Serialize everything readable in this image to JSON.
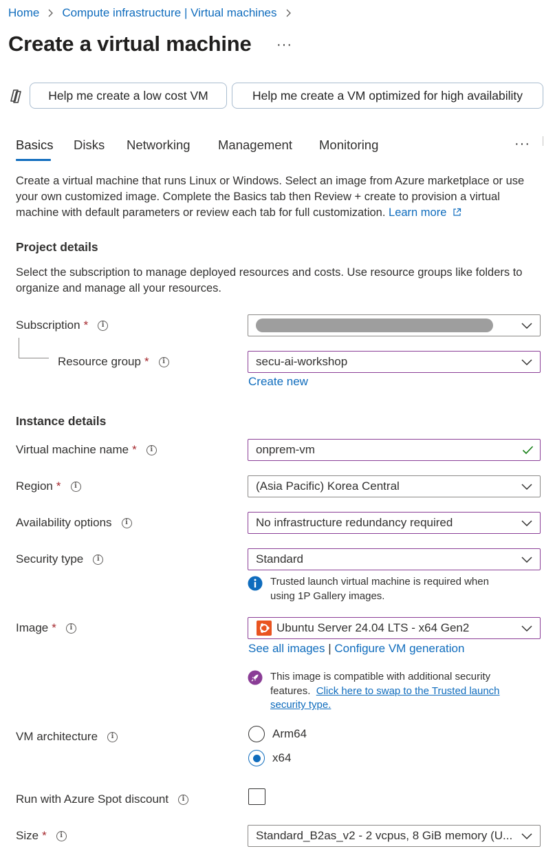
{
  "breadcrumb": {
    "items": [
      "Home",
      "Compute infrastructure | Virtual machines"
    ]
  },
  "page": {
    "title": "Create a virtual machine",
    "more": "···"
  },
  "copilot": {
    "btn_low_cost": "Help me create a low cost VM",
    "btn_high_avail": "Help me create a VM optimized for high availability"
  },
  "tabs": {
    "items": [
      "Basics",
      "Disks",
      "Networking",
      "Management",
      "Monitoring"
    ],
    "active": "Basics",
    "more": "···"
  },
  "intro": {
    "text": "Create a virtual machine that runs Linux or Windows. Select an image from Azure marketplace or use your own customized image. Complete the Basics tab then Review + create to provision a virtual machine with default parameters or review each tab for full customization.",
    "learn_more": "Learn more"
  },
  "project": {
    "heading": "Project details",
    "description": "Select the subscription to manage deployed resources and costs. Use resource groups like folders to organize and manage all your resources.",
    "subscription_label": "Subscription",
    "resource_group_label": "Resource group",
    "resource_group_value": "secu-ai-workshop",
    "create_new": "Create new"
  },
  "instance": {
    "heading": "Instance details",
    "vm_name_label": "Virtual machine name",
    "vm_name_value": "onprem-vm",
    "region_label": "Region",
    "region_value": "(Asia Pacific) Korea Central",
    "availability_label": "Availability options",
    "availability_value": "No infrastructure redundancy required",
    "security_label": "Security type",
    "security_value": "Standard",
    "security_note_line1": "Trusted launch virtual machine is required when",
    "security_note_line2": "using 1P Gallery images.",
    "image_label": "Image",
    "image_value": "Ubuntu Server 24.04 LTS - x64 Gen2",
    "see_all_images": "See all images",
    "link_sep": "|",
    "configure_generation": "Configure VM generation",
    "image_note_line1": "This image is compatible with additional security",
    "image_note_line2_prefix": "features.",
    "image_note_link_line1": "Click here to swap to the Trusted launch",
    "image_note_link_line2": "security type.",
    "arch_label": "VM architecture",
    "arch_options": [
      "Arm64",
      "x64"
    ],
    "arch_selected": "x64",
    "spot_label": "Run with Azure Spot discount",
    "size_label": "Size",
    "size_value": "Standard_B2as_v2 - 2 vcpus, 8 GiB memory (U..."
  },
  "required_mark": "*",
  "info_glyph": "i",
  "colors": {
    "link": "#0f6cbd",
    "required": "#a4262c",
    "field_border_active": "#8a3d96",
    "info_blue": "#0f6cbd",
    "ubuntu_orange": "#e95420",
    "security_purple": "#8a3d96",
    "check_green": "#107c10"
  }
}
